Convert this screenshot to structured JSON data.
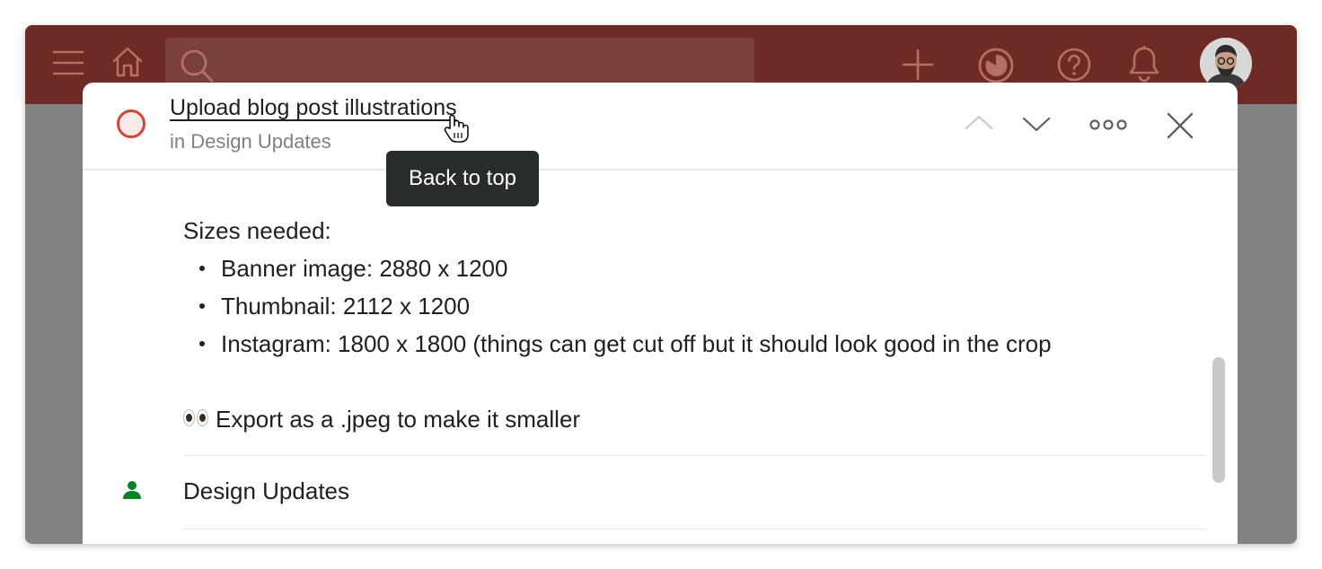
{
  "topbar": {
    "menu_icon": "hamburger-menu-icon",
    "home_icon": "home-icon",
    "search": {
      "icon": "search-icon",
      "value": "",
      "placeholder": ""
    },
    "add_icon": "plus-icon",
    "productivity_icon": "karma-pie-icon",
    "help_icon": "question-mark-icon",
    "notifications_icon": "bell-icon",
    "avatar_icon": "user-avatar-icon",
    "colors": {
      "bar": "#6e2a25",
      "icon": "#b46f68"
    }
  },
  "task": {
    "title": "Upload blog post illustrations",
    "project_label": "in Design Updates",
    "tooltip": "Back to top",
    "priority_color": "#d1453b",
    "header_icons": [
      "chevron-up-icon",
      "chevron-down-icon",
      "more-options-icon",
      "close-icon"
    ],
    "description": {
      "heading": "Sizes needed:",
      "sizes": [
        "Banner image: 2880 x 1200",
        "Thumbnail: 2112 x 1200",
        "Instagram: 1800 x 1800 (things can get cut off but it should look good in the crop"
      ],
      "note_icon": "eyes-emoji-icon",
      "note": "Export as a .jpeg to make it smaller"
    },
    "project": {
      "icon": "person-icon",
      "icon_color": "#058527",
      "name": "Design Updates"
    }
  }
}
